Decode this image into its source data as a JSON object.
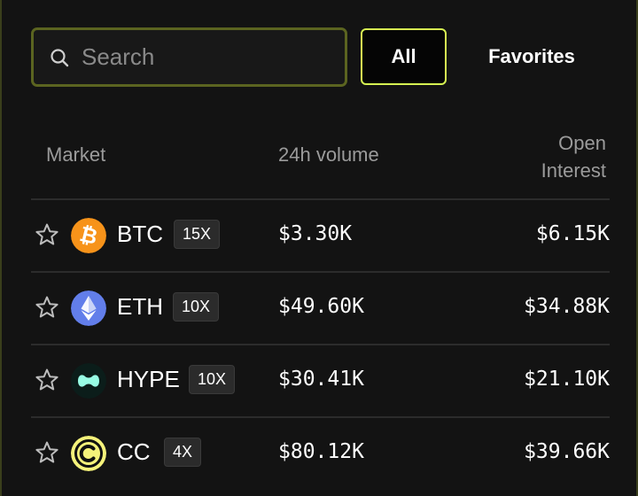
{
  "search": {
    "placeholder": "Search",
    "value": ""
  },
  "filters": {
    "all_label": "All",
    "favorites_label": "Favorites"
  },
  "columns": {
    "market": "Market",
    "volume": "24h volume",
    "open_interest_line1": "Open",
    "open_interest_line2": "Interest"
  },
  "colors": {
    "accent": "#d6f252",
    "search_border": "#5b6420",
    "btc": "#f7931a",
    "eth": "#627eea",
    "hype": "#97fce4",
    "cc": "#f5f27a"
  },
  "markets": [
    {
      "symbol": "BTC",
      "leverage": "15X",
      "volume": "$3.30K",
      "open_interest": "$6.15K",
      "icon": "bitcoin-icon"
    },
    {
      "symbol": "ETH",
      "leverage": "10X",
      "volume": "$49.60K",
      "open_interest": "$34.88K",
      "icon": "ethereum-icon"
    },
    {
      "symbol": "HYPE",
      "leverage": "10X",
      "volume": "$30.41K",
      "open_interest": "$21.10K",
      "icon": "hyperliquid-icon"
    },
    {
      "symbol": "CC",
      "leverage": "4X",
      "volume": "$80.12K",
      "open_interest": "$39.66K",
      "icon": "cc-icon"
    }
  ]
}
